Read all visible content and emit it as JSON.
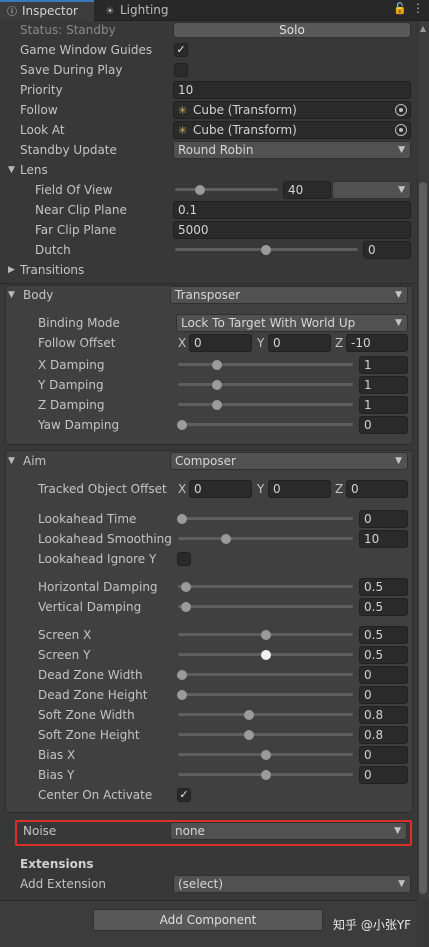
{
  "tabs": [
    {
      "label": "Inspector",
      "icon": "info-icon"
    },
    {
      "label": "Lighting",
      "icon": "lighting-icon"
    }
  ],
  "header": {
    "lock_icon": "lock-icon",
    "more_icon": "kebab-menu-icon"
  },
  "main": {
    "status_label": "Status: Standby",
    "solo_button": "Solo",
    "game_window_guides_label": "Game Window Guides",
    "game_window_guides_checked": true,
    "save_during_play_label": "Save During Play",
    "save_during_play_checked": false,
    "priority_label": "Priority",
    "priority_value": "10",
    "follow_label": "Follow",
    "follow_value": "Cube (Transform)",
    "look_at_label": "Look At",
    "look_at_value": "Cube (Transform)",
    "standby_update_label": "Standby Update",
    "standby_update_value": "Round Robin"
  },
  "lens": {
    "label": "Lens",
    "fov_label": "Field Of View",
    "fov_value": "40",
    "near_label": "Near Clip Plane",
    "near_value": "0.1",
    "far_label": "Far Clip Plane",
    "far_value": "5000",
    "dutch_label": "Dutch",
    "dutch_value": "0"
  },
  "transitions": {
    "label": "Transitions"
  },
  "body": {
    "label": "Body",
    "value": "Transposer",
    "binding_mode_label": "Binding Mode",
    "binding_mode_value": "Lock To Target With World Up",
    "follow_offset_label": "Follow Offset",
    "follow_offset": {
      "x_label": "X",
      "x": "0",
      "y_label": "Y",
      "y": "0",
      "z_label": "Z",
      "z": "-10"
    },
    "x_damping_label": "X Damping",
    "x_damping_value": "1",
    "y_damping_label": "Y Damping",
    "y_damping_value": "1",
    "z_damping_label": "Z Damping",
    "z_damping_value": "1",
    "yaw_damping_label": "Yaw Damping",
    "yaw_damping_value": "0"
  },
  "aim": {
    "label": "Aim",
    "value": "Composer",
    "tracked_offset_label": "Tracked Object Offset",
    "tracked_offset": {
      "x_label": "X",
      "x": "0",
      "y_label": "Y",
      "y": "0",
      "z_label": "Z",
      "z": "0"
    },
    "lookahead_time_label": "Lookahead Time",
    "lookahead_time_value": "0",
    "lookahead_smoothing_label": "Lookahead Smoothing",
    "lookahead_smoothing_value": "10",
    "lookahead_ignore_y_label": "Lookahead Ignore Y",
    "lookahead_ignore_y_checked": false,
    "horizontal_damping_label": "Horizontal Damping",
    "horizontal_damping_value": "0.5",
    "vertical_damping_label": "Vertical Damping",
    "vertical_damping_value": "0.5",
    "screen_x_label": "Screen X",
    "screen_x_value": "0.5",
    "screen_y_label": "Screen Y",
    "screen_y_value": "0.5",
    "dead_zone_width_label": "Dead Zone Width",
    "dead_zone_width_value": "0",
    "dead_zone_height_label": "Dead Zone Height",
    "dead_zone_height_value": "0",
    "soft_zone_width_label": "Soft Zone Width",
    "soft_zone_width_value": "0.8",
    "soft_zone_height_label": "Soft Zone Height",
    "soft_zone_height_value": "0.8",
    "bias_x_label": "Bias X",
    "bias_x_value": "0",
    "bias_y_label": "Bias Y",
    "bias_y_value": "0",
    "center_on_activate_label": "Center On Activate",
    "center_on_activate_checked": true
  },
  "noise": {
    "label": "Noise",
    "value": "none"
  },
  "extensions": {
    "heading": "Extensions",
    "add_label": "Add Extension",
    "add_value": "(select)"
  },
  "footer": {
    "add_component_button": "Add Component",
    "watermark": "知乎 @小张YF"
  },
  "colors": {
    "background": "#383838",
    "accent_tab": "#3a79bb",
    "highlight_box": "#d9302a"
  }
}
